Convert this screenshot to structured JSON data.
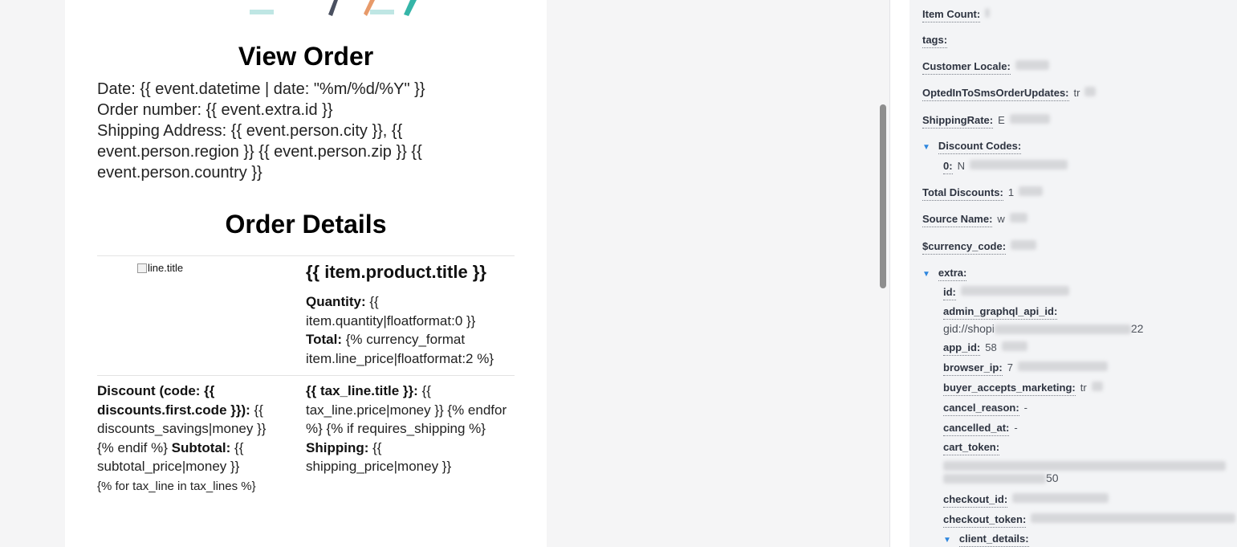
{
  "email": {
    "heading": "View Order",
    "date_line": "Date: {{ event.datetime | date: \"%m/%d/%Y\" }}",
    "order_line": "Order number: {{ event.extra.id }}",
    "shipping_line": "Shipping Address: {{ event.person.city }}, {{ event.person.region }} {{ event.person.zip }} {{ event.person.country }}",
    "details_heading": "Order Details",
    "image_alt": "line.title",
    "product_title": "{{ item.product.title }}",
    "quantity_label": "Quantity:",
    "quantity_value": "{{ item.quantity|floatformat:0 }}",
    "total_label": "Total:",
    "total_value": "{% currency_format item.line_price|floatformat:2 %}",
    "discount_label": "Discount (code: {{ discounts.first.code }}):",
    "discount_value": "{{ discounts_savings|money }} {% endif %}",
    "subtotal_label": "Subtotal:",
    "subtotal_value": "{{ subtotal_price|money }}",
    "for_loop": "{% for tax_line in tax_lines %}",
    "tax_label": "{{ tax_line.title }}:",
    "tax_value": "{{ tax_line.price|money }} {% endfor %} {% if requires_shipping %}",
    "shipping_label": "Shipping:",
    "shipping_value": "{{ shipping_price|money }}"
  },
  "panel": {
    "item_count": {
      "label": "Item Count:"
    },
    "tags": {
      "label": "tags:"
    },
    "customer_locale": {
      "label": "Customer Locale:"
    },
    "opted_in": {
      "label": "OptedInToSmsOrderUpdates:",
      "value": "tr"
    },
    "shipping_rate": {
      "label": "ShippingRate:",
      "value": "E"
    },
    "discount_codes": {
      "label": "Discount Codes:",
      "item_label": "0:",
      "item_value": "N"
    },
    "total_discounts": {
      "label": "Total Discounts:",
      "value": "1"
    },
    "source_name": {
      "label": "Source Name:",
      "value": "w"
    },
    "currency_code": {
      "label": "$currency_code:"
    },
    "extra": {
      "label": "extra:",
      "id": {
        "label": "id:"
      },
      "admin_graphql_api_id": {
        "label": "admin_graphql_api_id:",
        "value": "gid://shopi",
        "value_end": "22"
      },
      "app_id": {
        "label": "app_id:",
        "value": "58"
      },
      "browser_ip": {
        "label": "browser_ip:",
        "value": "7"
      },
      "buyer_accepts_marketing": {
        "label": "buyer_accepts_marketing:",
        "value": "tr"
      },
      "cancel_reason": {
        "label": "cancel_reason:",
        "value": "-"
      },
      "cancelled_at": {
        "label": "cancelled_at:",
        "value": "-"
      },
      "cart_token": {
        "label": "cart_token:",
        "value_end": "50"
      },
      "checkout_id": {
        "label": "checkout_id:"
      },
      "checkout_token": {
        "label": "checkout_token:"
      },
      "client_details": {
        "label": "client_details:"
      }
    }
  },
  "colors": {
    "accent": "#2e86de",
    "panel_bg": "#f3f4f6",
    "page_bg": "#f5f5f6",
    "scrollbar": "#8e8e8e"
  },
  "icons": [
    "expand-triangle-icon",
    "broken-image-icon"
  ]
}
